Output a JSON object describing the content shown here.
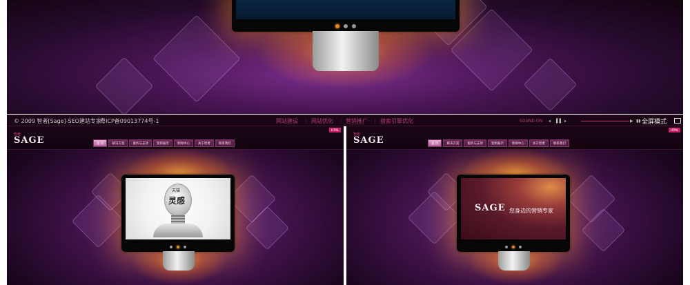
{
  "footer": {
    "copyright": "© 2009 智者[Sage]-SEO建站专家",
    "icp": "粤ICP备09013774号-1",
    "links": [
      "网站建设",
      "网站优化",
      "营销推广",
      "搜索引擎优化"
    ],
    "separator": "|",
    "sound_label": "SOUND ON",
    "fullscreen_label": "全屏模式"
  },
  "site": {
    "logo_text": "SAGE",
    "logo_sub": "智者",
    "badge": "HTML",
    "nav": [
      "首 页",
      "解决方案",
      "服务与支持",
      "案例展示",
      "新闻中心",
      "关于智者",
      "联系我们"
    ]
  },
  "screens": {
    "left_bulb_small": "天猫",
    "left_bulb_text": "灵感",
    "right_slogan": "您身边的营销专家"
  },
  "icons": {
    "prev": "◂",
    "pause": "▌▌",
    "next": "▸",
    "play": "▶",
    "volume": "▮▮",
    "fullscreen": "fullscreen-icon"
  },
  "colors": {
    "accent": "#b33c6e",
    "active_dot": "#e8861f"
  }
}
